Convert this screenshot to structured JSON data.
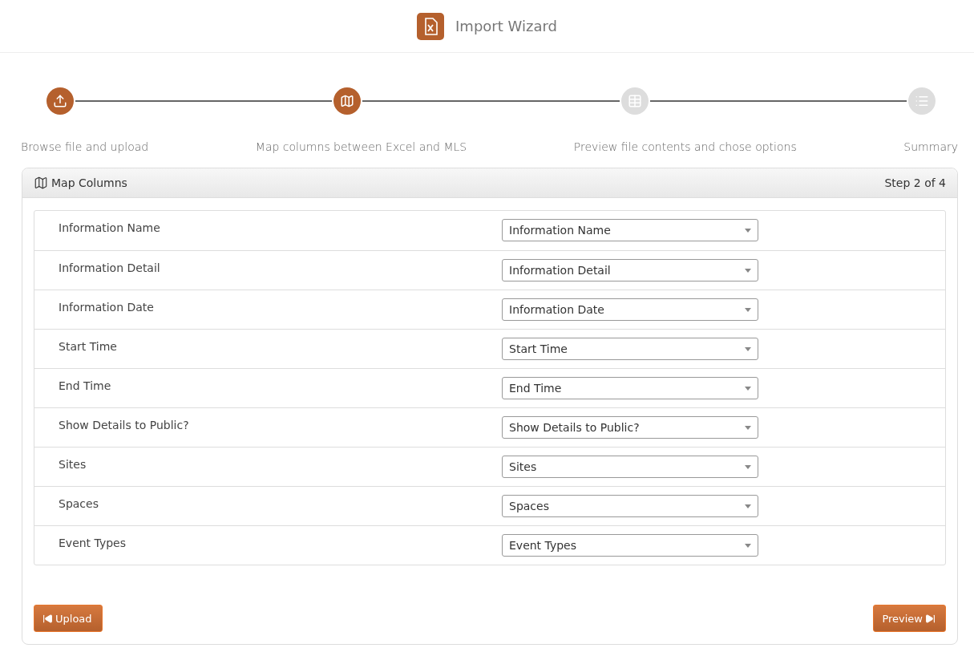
{
  "header": {
    "title": "Import Wizard"
  },
  "steps": [
    {
      "label": "Browse file and upload",
      "done": true,
      "kind": "upload"
    },
    {
      "label": "Map columns between Excel and MLS",
      "done": true,
      "kind": "map"
    },
    {
      "label": "Preview file contents and chose options",
      "done": false,
      "kind": "table"
    },
    {
      "label": "Summary",
      "done": false,
      "kind": "list"
    }
  ],
  "panel": {
    "title": "Map Columns",
    "step_info": "Step 2 of 4"
  },
  "mappings": [
    {
      "label": "Information Name",
      "value": "Information Name"
    },
    {
      "label": "Information Detail",
      "value": "Information Detail"
    },
    {
      "label": "Information Date",
      "value": "Information Date"
    },
    {
      "label": "Start Time",
      "value": "Start Time"
    },
    {
      "label": "End Time",
      "value": "End Time"
    },
    {
      "label": "Show Details to Public?",
      "value": "Show Details to Public?"
    },
    {
      "label": "Sites",
      "value": "Sites"
    },
    {
      "label": "Spaces",
      "value": "Spaces"
    },
    {
      "label": "Event Types",
      "value": "Event Types"
    }
  ],
  "buttons": {
    "back": "Upload",
    "next": "Preview"
  }
}
